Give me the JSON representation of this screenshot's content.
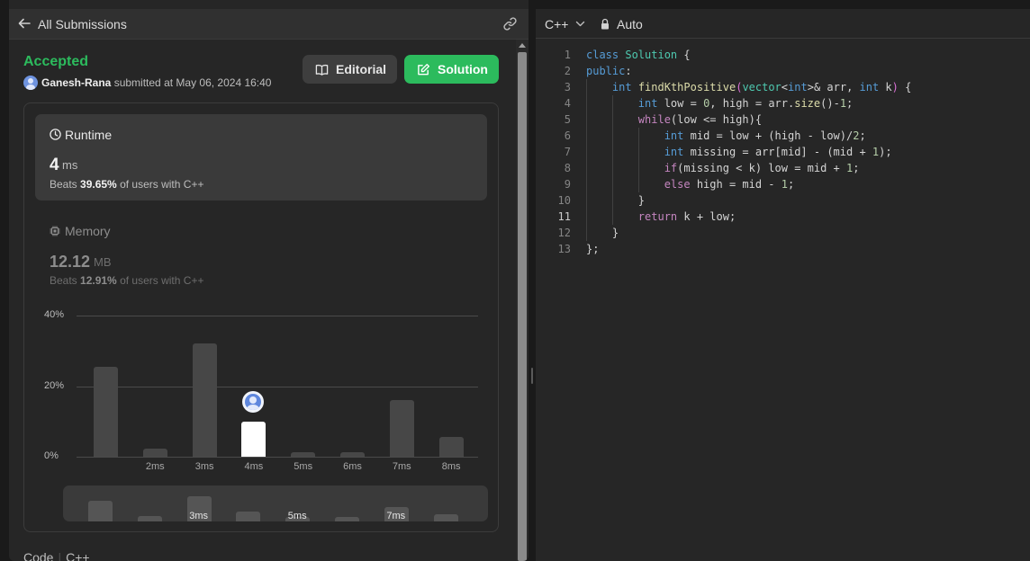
{
  "left_panel": {
    "back_label": "All Submissions",
    "status": "Accepted",
    "submitter_name": "Ganesh-Rana",
    "submitted_text": "submitted at May 06, 2024 16:40",
    "editorial_label": "Editorial",
    "solution_label": "Solution",
    "accent_color": "#2cbb5d"
  },
  "runtime": {
    "title": "Runtime",
    "value": "4",
    "unit": "ms",
    "beats_prefix": "Beats",
    "beats_value": "39.65%",
    "beats_suffix": "of users with C++"
  },
  "memory": {
    "title": "Memory",
    "value": "12.12",
    "unit": "MB",
    "beats_prefix": "Beats",
    "beats_value": "12.91%",
    "beats_suffix": "of users with C++"
  },
  "chart_data": {
    "type": "bar",
    "categories": [
      "",
      "2ms",
      "3ms",
      "4ms",
      "5ms",
      "6ms",
      "7ms",
      "8ms"
    ],
    "values": [
      25.5,
      2.2,
      32,
      10,
      1.4,
      1.4,
      16,
      5.5
    ],
    "selected_index": 3,
    "y_ticks": [
      "40%",
      "20%",
      "0%"
    ],
    "ylim": [
      0,
      40
    ],
    "grid": true
  },
  "minimap": {
    "labels": [
      "3ms",
      "5ms",
      "7ms"
    ]
  },
  "footer": {
    "code_label": "Code",
    "language": "C++"
  },
  "editor": {
    "language": "C++",
    "mode": "Auto",
    "active_line": 11,
    "line_numbers": [
      "1",
      "2",
      "3",
      "4",
      "5",
      "6",
      "7",
      "8",
      "9",
      "10",
      "11",
      "12",
      "13"
    ]
  },
  "icons": [
    "arrow-left-icon",
    "link-icon",
    "book-icon",
    "edit-icon",
    "clock-icon",
    "chip-icon",
    "avatar-icon",
    "chevron-down-icon",
    "lock-icon"
  ]
}
